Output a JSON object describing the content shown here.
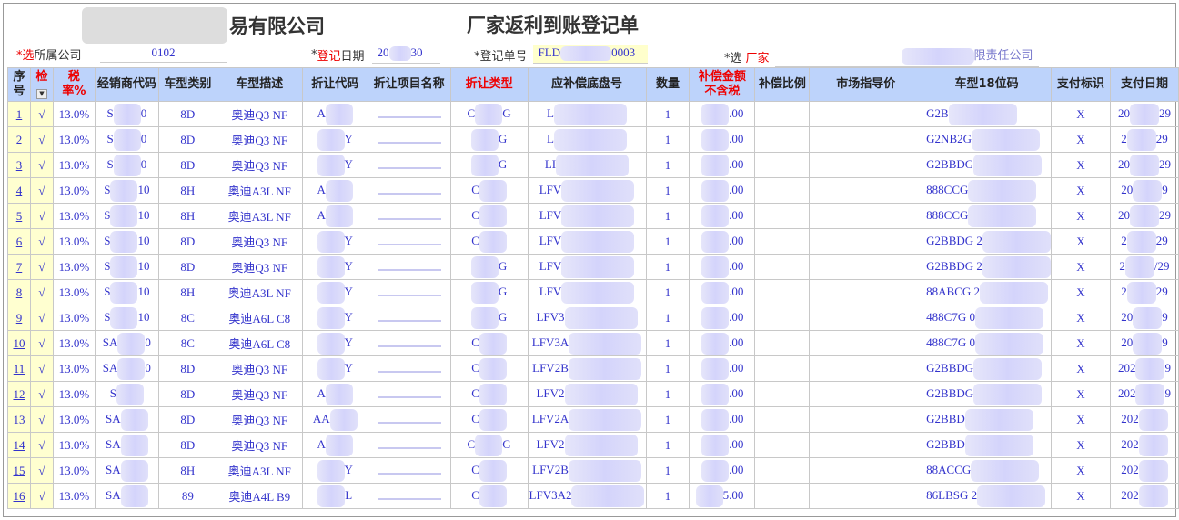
{
  "header": {
    "company_suffix": "易有限公司",
    "form_title": "厂家返利到账登记单"
  },
  "meta": {
    "company": {
      "star": "*选",
      "label": "所属公司",
      "value": "0102"
    },
    "date": {
      "star": "*",
      "label_red": "登记",
      "label": "日期",
      "value_pre": "20",
      "value_suf": "30"
    },
    "number": {
      "label": "*登记单号",
      "value_pre": "FLD",
      "value_suf": "0003"
    },
    "vendor": {
      "label": "*选",
      "label_red": "厂家",
      "value_suf": "限责任公司"
    }
  },
  "columns": [
    {
      "label": "序号",
      "red": false
    },
    {
      "label": "检",
      "red": true
    },
    {
      "label": "税率%",
      "red": true
    },
    {
      "label": "经销商代码",
      "red": false
    },
    {
      "label": "车型类别",
      "red": false
    },
    {
      "label": "车型描述",
      "red": false
    },
    {
      "label": "折让代码",
      "red": false
    },
    {
      "label": "折让项目名称",
      "red": false
    },
    {
      "label": "折让类型",
      "red": true
    },
    {
      "label": "应补偿底盘号",
      "red": false
    },
    {
      "label": "数量",
      "red": false
    },
    {
      "label": "补偿金额不含税",
      "red": true
    },
    {
      "label": "补偿比例",
      "red": false
    },
    {
      "label": "市场指导价",
      "red": false
    },
    {
      "label": "车型18位码",
      "red": false
    },
    {
      "label": "支付标识",
      "red": false
    },
    {
      "label": "支付日期",
      "red": false
    }
  ],
  "row_defaults": {
    "check": "√",
    "tax": "13.0%",
    "qty": "1",
    "pay_flag": "X"
  },
  "rows": [
    [
      "1",
      "S",
      "0",
      "8D",
      "奥迪Q3 NF",
      "A",
      "",
      "C",
      "G",
      "L",
      ".00",
      "G2B",
      "20",
      "29"
    ],
    [
      "2",
      "S",
      "0",
      "8D",
      "奥迪Q3 NF",
      "",
      "Y",
      "",
      "G",
      "L",
      ".00",
      "G2NB2G",
      "2",
      "29"
    ],
    [
      "3",
      "S",
      "0",
      "8D",
      "奥迪Q3 NF",
      "",
      "Y",
      "",
      "G",
      "LI",
      ".00",
      "G2BBDG",
      "20",
      "29"
    ],
    [
      "4",
      "S",
      "10",
      "8H",
      "奥迪A3L NF",
      "A",
      "",
      "C",
      "",
      "LFV",
      ".00",
      "888CCG",
      "20",
      "9"
    ],
    [
      "5",
      "S",
      "10",
      "8H",
      "奥迪A3L NF",
      "A",
      "",
      "C",
      "",
      "LFV",
      ".00",
      "888CCG",
      "20",
      "29"
    ],
    [
      "6",
      "S",
      "10",
      "8D",
      "奥迪Q3 NF",
      "",
      "Y",
      "C",
      "",
      "LFV",
      ".00",
      "G2BBDG 2",
      "2",
      "29"
    ],
    [
      "7",
      "S",
      "10",
      "8D",
      "奥迪Q3 NF",
      "",
      "Y",
      "",
      "G",
      "LFV",
      ".00",
      "G2BBDG 2",
      "2",
      "/29"
    ],
    [
      "8",
      "S",
      "10",
      "8H",
      "奥迪A3L NF",
      "",
      "Y",
      "",
      "G",
      "LFV",
      ".00",
      "88ABCG 2",
      "2",
      "29"
    ],
    [
      "9",
      "S",
      "10",
      "8C",
      "奥迪A6L C8",
      "",
      "Y",
      "",
      "G",
      "LFV3",
      ".00",
      "488C7G 0",
      "20",
      "9"
    ],
    [
      "10",
      "SA",
      "0",
      "8C",
      "奥迪A6L C8",
      "",
      "Y",
      "C",
      "",
      "LFV3A",
      ".00",
      "488C7G 0",
      "20",
      "9"
    ],
    [
      "11",
      "SA",
      "0",
      "8D",
      "奥迪Q3 NF",
      "",
      "Y",
      "C",
      "",
      "LFV2B",
      ".00",
      "G2BBDG",
      "202",
      "9"
    ],
    [
      "12",
      "S",
      "",
      "8D",
      "奥迪Q3 NF",
      "A",
      "",
      "C",
      "",
      "LFV2",
      ".00",
      "G2BBDG",
      "202",
      "9"
    ],
    [
      "13",
      "SA",
      "",
      "8D",
      "奥迪Q3 NF",
      "AA",
      "",
      "C",
      "",
      "LFV2A",
      ".00",
      "G2BBD",
      "202",
      ""
    ],
    [
      "14",
      "SA",
      "",
      "8D",
      "奥迪Q3 NF",
      "A",
      "",
      "C",
      "G",
      "LFV2",
      ".00",
      "G2BBD",
      "202",
      ""
    ],
    [
      "15",
      "SA",
      "",
      "8H",
      "奥迪A3L NF",
      "",
      "Y",
      "C",
      "",
      "LFV2B",
      ".00",
      "88ACCG",
      "202",
      ""
    ],
    [
      "16",
      "SA",
      "",
      "89",
      "奥迪A4L B9",
      "",
      "L",
      "C",
      "",
      "LFV3A2",
      "5.00",
      "86LBSG 2",
      "202",
      ""
    ]
  ]
}
